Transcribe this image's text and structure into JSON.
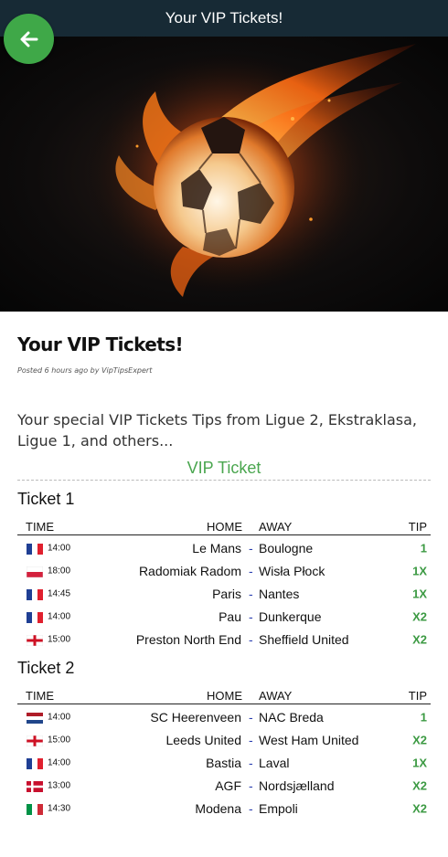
{
  "header": {
    "title": "Your VIP Tickets!"
  },
  "post": {
    "title": "Your VIP Tickets!",
    "meta": "Posted 6 hours ago by VipTipsExpert",
    "intro": "Your special VIP Tickets Tips from Ligue 2, Ekstraklasa, Ligue 1, and others...",
    "section_heading": "VIP Ticket"
  },
  "columns": {
    "time": "TIME",
    "home": "HOME",
    "away": "AWAY",
    "tip": "TIP"
  },
  "separator": "-",
  "tickets": [
    {
      "title": "Ticket 1",
      "matches": [
        {
          "flag": "france",
          "time": "14:00",
          "home": "Le Mans",
          "away": "Boulogne",
          "tip": "1"
        },
        {
          "flag": "poland",
          "time": "18:00",
          "home": "Radomiak Radom",
          "away": "Wisła Płock",
          "tip": "1X"
        },
        {
          "flag": "france",
          "time": "14:45",
          "home": "Paris",
          "away": "Nantes",
          "tip": "1X"
        },
        {
          "flag": "france",
          "time": "14:00",
          "home": "Pau",
          "away": "Dunkerque",
          "tip": "X2"
        },
        {
          "flag": "england",
          "time": "15:00",
          "home": "Preston North End",
          "away": "Sheffield United",
          "tip": "X2"
        }
      ]
    },
    {
      "title": "Ticket 2",
      "matches": [
        {
          "flag": "netherlands",
          "time": "14:00",
          "home": "SC Heerenveen",
          "away": "NAC Breda",
          "tip": "1"
        },
        {
          "flag": "england",
          "time": "15:00",
          "home": "Leeds United",
          "away": "West Ham United",
          "tip": "X2"
        },
        {
          "flag": "france",
          "time": "14:00",
          "home": "Bastia",
          "away": "Laval",
          "tip": "1X"
        },
        {
          "flag": "denmark",
          "time": "13:00",
          "home": "AGF",
          "away": "Nordsjælland",
          "tip": "X2"
        },
        {
          "flag": "italy",
          "time": "14:30",
          "home": "Modena",
          "away": "Empoli",
          "tip": "X2"
        }
      ]
    }
  ],
  "icons": {
    "back": "arrow-left-icon",
    "hero": "flaming-soccer-ball"
  },
  "colors": {
    "topbar": "#172a35",
    "back_button": "#3fa848",
    "accent": "#4aa64f",
    "tip": "#3c9a43",
    "separator": "#2b3fb0"
  }
}
